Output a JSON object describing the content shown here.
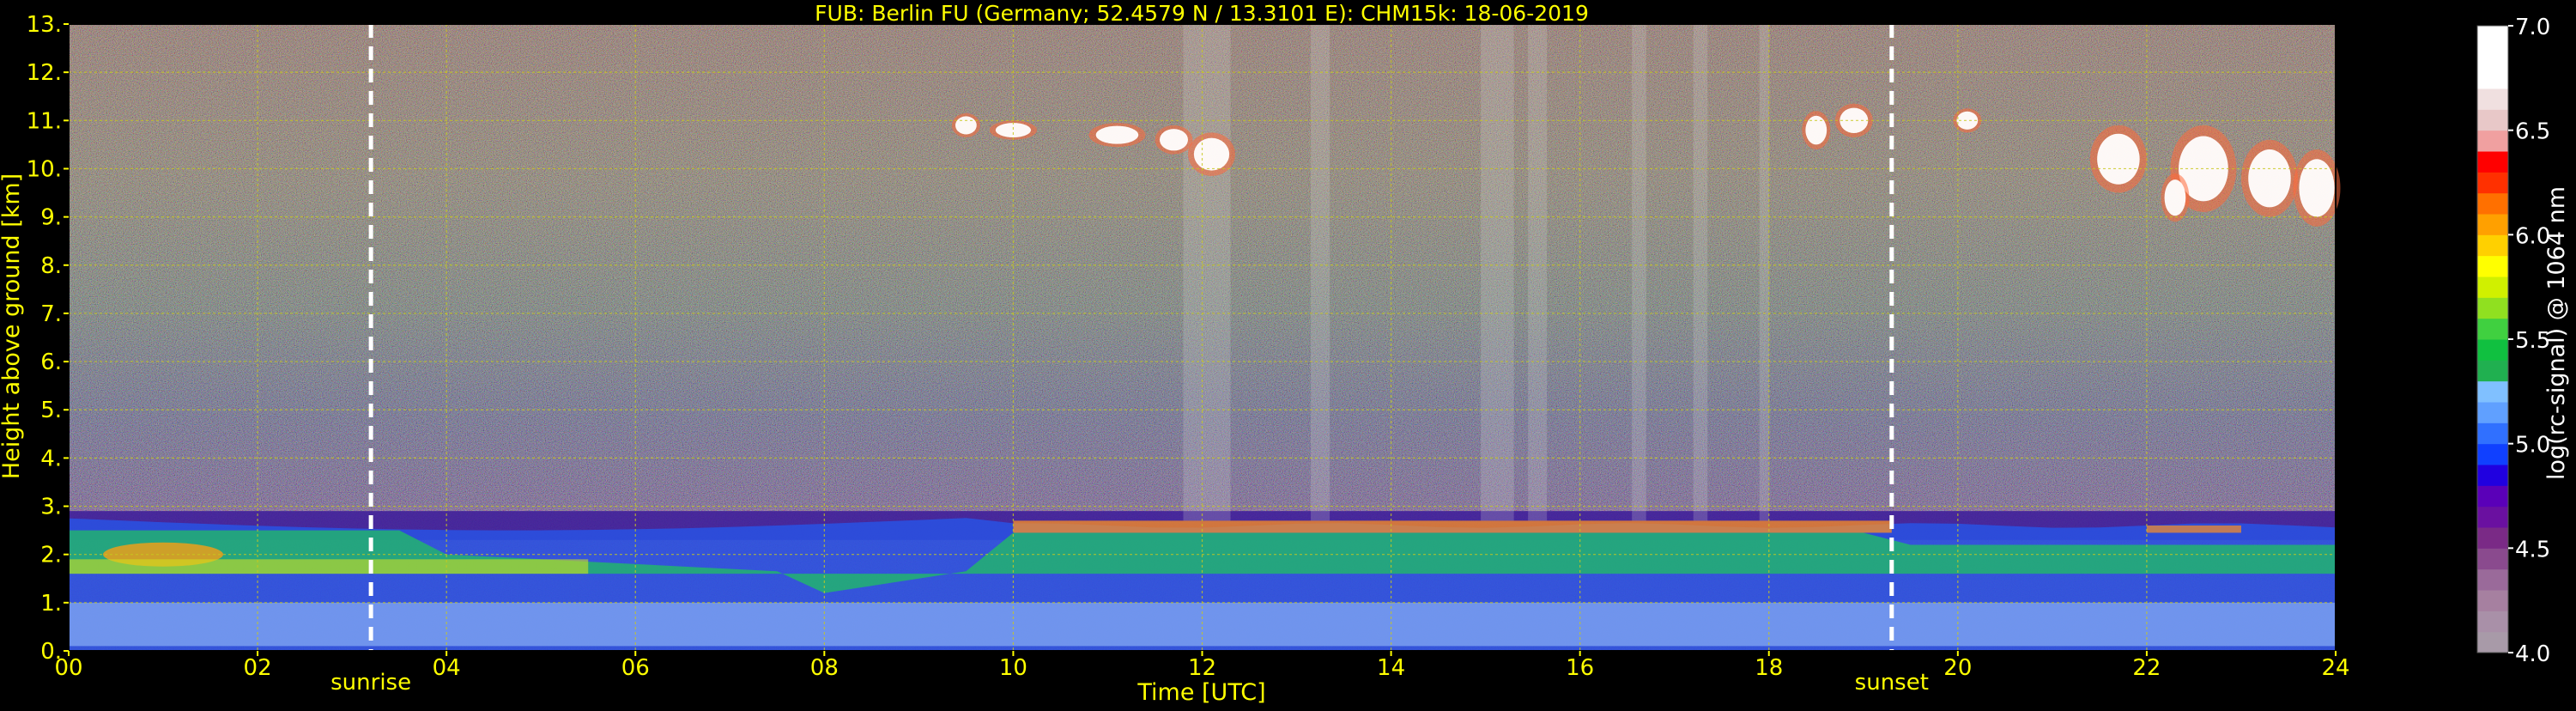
{
  "header": {
    "title": "FUB: Berlin FU (Germany; 52.4579 N / 13.3101 E):    CHM15k: 18-06-2019"
  },
  "colors": {
    "background": "#000000",
    "text_axis": "#ffff00",
    "text_colorbar": "#ffffff",
    "grid": "#c8c81e",
    "marker_line": "#ffffff"
  },
  "chart_data": {
    "type": "heatmap",
    "title": "FUB: Berlin FU (Germany; 52.4579 N / 13.3101 E):    CHM15k: 18-06-2019",
    "xlabel": "Time [UTC]",
    "ylabel": "Height above ground [km]",
    "xlim": [
      0,
      24
    ],
    "ylim": [
      0,
      13
    ],
    "x_ticks": [
      {
        "value": 0,
        "label": "00"
      },
      {
        "value": 2,
        "label": "02"
      },
      {
        "value": 4,
        "label": "04"
      },
      {
        "value": 6,
        "label": "06"
      },
      {
        "value": 8,
        "label": "08"
      },
      {
        "value": 10,
        "label": "10"
      },
      {
        "value": 12,
        "label": "12"
      },
      {
        "value": 14,
        "label": "14"
      },
      {
        "value": 16,
        "label": "16"
      },
      {
        "value": 18,
        "label": "18"
      },
      {
        "value": 20,
        "label": "20"
      },
      {
        "value": 22,
        "label": "22"
      },
      {
        "value": 24,
        "label": "24"
      }
    ],
    "y_ticks": [
      {
        "value": 0,
        "label": "0."
      },
      {
        "value": 1,
        "label": "1."
      },
      {
        "value": 2,
        "label": "2."
      },
      {
        "value": 3,
        "label": "3."
      },
      {
        "value": 4,
        "label": "4."
      },
      {
        "value": 5,
        "label": "5."
      },
      {
        "value": 6,
        "label": "6."
      },
      {
        "value": 7,
        "label": "7."
      },
      {
        "value": 8,
        "label": "8."
      },
      {
        "value": 9,
        "label": "9."
      },
      {
        "value": 10,
        "label": "10."
      },
      {
        "value": 11,
        "label": "11."
      },
      {
        "value": 12,
        "label": "12."
      },
      {
        "value": 13,
        "label": "13."
      }
    ],
    "grid": true,
    "events": [
      {
        "name": "sunrise",
        "time": 3.2
      },
      {
        "name": "sunset",
        "time": 19.3
      }
    ],
    "colorbar": {
      "label": "log(rc-signal) @ 1064 nm",
      "range": [
        4.0,
        7.0
      ],
      "ticks": [
        {
          "value": 4.0,
          "label": "4.0"
        },
        {
          "value": 4.5,
          "label": "4.5"
        },
        {
          "value": 5.0,
          "label": "5.0"
        },
        {
          "value": 5.5,
          "label": "5.5"
        },
        {
          "value": 6.0,
          "label": "6.0"
        },
        {
          "value": 6.5,
          "label": "6.5"
        },
        {
          "value": 7.0,
          "label": "7.0"
        }
      ],
      "colors": [
        "#a89aa8",
        "#a990a8",
        "#a680a0",
        "#9a6a9a",
        "#8a4a8e",
        "#7a2a86",
        "#6a10a0",
        "#5a00b8",
        "#2000e0",
        "#1040ff",
        "#3070ff",
        "#60a0ff",
        "#80c0ff",
        "#20b050",
        "#10c040",
        "#40d040",
        "#90e020",
        "#d0f000",
        "#ffff00",
        "#ffd000",
        "#ffa000",
        "#ff7000",
        "#ff3000",
        "#ff0000",
        "#f0a0a0",
        "#e8c8c8",
        "#f0e0e0",
        "#ffffff",
        "#ffffff",
        "#ffffff"
      ]
    },
    "layers": [
      {
        "name": "noise-background",
        "height_range": [
          3.0,
          13.0
        ],
        "mean_log_signal": 5.3
      },
      {
        "name": "residual-layer",
        "height_range": [
          0.0,
          2.8
        ],
        "mean_log_signal": 5.2
      },
      {
        "name": "boundary-layer-top",
        "time_range": [
          10.0,
          24.0
        ],
        "top_height": 2.6
      },
      {
        "name": "cirrus-clouds",
        "time_range": [
          9.0,
          24.0
        ],
        "height_range": [
          8.5,
          11.5
        ],
        "mean_log_signal": 7.0
      }
    ]
  }
}
